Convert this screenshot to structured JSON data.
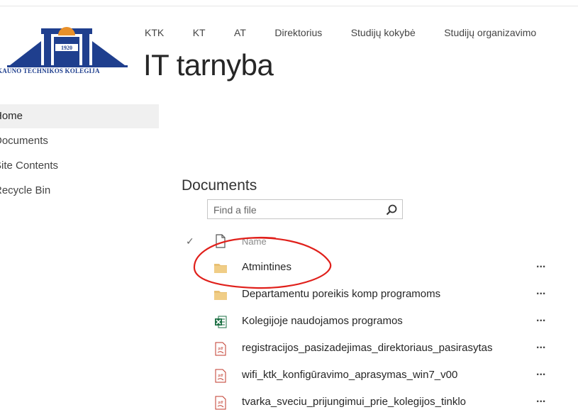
{
  "logo": {
    "year": "1920",
    "caption": "KAUNO TECHNIKOS KOLEGIJA",
    "colors": {
      "blue": "#1f3f8e",
      "orange": "#e8902a"
    }
  },
  "top_nav": {
    "items": [
      "KTK",
      "KT",
      "AT",
      "Direktorius",
      "Studijų kokybė",
      "Studijų organizavimo"
    ]
  },
  "site_title": "IT tarnyba",
  "left_nav": {
    "items": [
      {
        "label": "Home",
        "selected": true
      },
      {
        "label": "Documents",
        "selected": false
      },
      {
        "label": "Site Contents",
        "selected": false
      },
      {
        "label": "Recycle Bin",
        "selected": false
      }
    ]
  },
  "documents": {
    "title": "Documents",
    "search": {
      "placeholder": "Find a file",
      "icon": "search-icon"
    },
    "header": {
      "check_icon": "checkmark-icon",
      "doc_icon": "document-icon",
      "name_label": "Name"
    },
    "items": [
      {
        "name": "Atmintines",
        "type": "folder"
      },
      {
        "name": "Departamentu poreikis komp programoms",
        "type": "folder"
      },
      {
        "name": "Kolegijoje naudojamos programos",
        "type": "excel"
      },
      {
        "name": "registracijos_pasizadejimas_direktoriaus_pasirasytas",
        "type": "pdf"
      },
      {
        "name": "wifi_ktk_konfigūravimo_aprasymas_win7_v00",
        "type": "pdf"
      },
      {
        "name": "tvarka_sveciu_prijungimui_prie_kolegijos_tinklo",
        "type": "pdf"
      }
    ],
    "more_label": "...",
    "colors": {
      "folder": "#e8c073",
      "excel": "#1e7145",
      "pdf": "#c0392b",
      "annotation": "#e0201b"
    }
  }
}
